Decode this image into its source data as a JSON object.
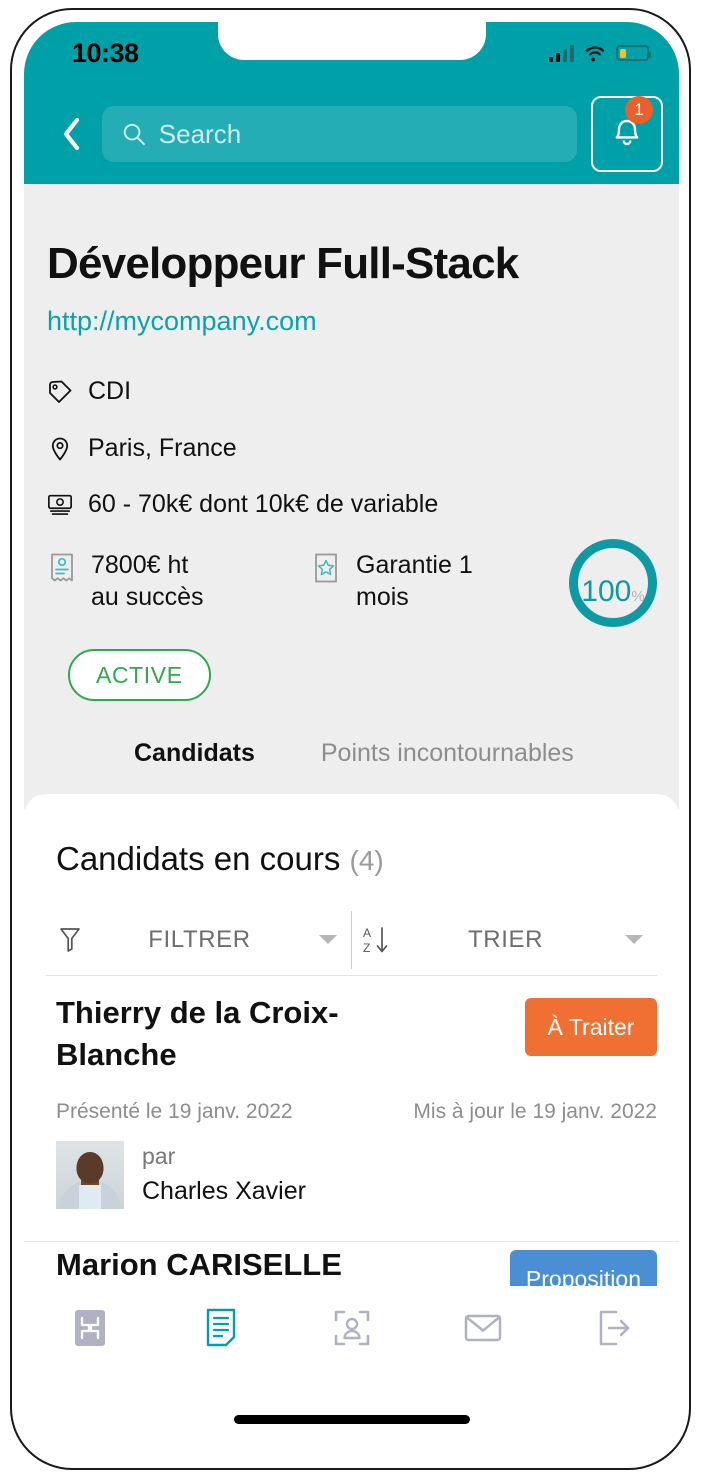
{
  "status_bar": {
    "time": "10:38",
    "signal_icon": "cellular-signal-icon",
    "wifi_icon": "wifi-icon",
    "battery_icon": "battery-low-icon",
    "battery_level_pct": 26
  },
  "header": {
    "back_icon": "chevron-left-icon",
    "search": {
      "icon": "search-icon",
      "placeholder": "Search",
      "value": ""
    },
    "notifications": {
      "icon": "bell-icon",
      "badge_count": "1"
    },
    "background_color": "#00a0a8"
  },
  "job": {
    "title": "Développeur Full-Stack",
    "url": "http://mycompany.com",
    "contract": {
      "icon": "tag-icon",
      "label": "CDI"
    },
    "location": {
      "icon": "map-pin-icon",
      "label": "Paris, France"
    },
    "salary": {
      "icon": "money-icon",
      "label": "60 - 70k€ dont 10k€ de variable"
    },
    "fee": {
      "icon": "receipt-icon",
      "line1": "7800€ ht",
      "line2": "au succès"
    },
    "guarantee": {
      "icon": "certificate-star-icon",
      "line1": "Garantie 1",
      "line2": "mois"
    },
    "score": {
      "value": "100",
      "unit": "%",
      "color": "#0d9aa3"
    },
    "status_badge": {
      "label": "ACTIVE",
      "color": "#2fa84f"
    }
  },
  "tabs": [
    {
      "label": "Candidats",
      "active": true
    },
    {
      "label": "Points incontournables",
      "active": false
    }
  ],
  "candidates_section": {
    "heading": "Candidats en cours",
    "count": "(4)",
    "filter": {
      "icon": "funnel-icon",
      "label": "FILTRER",
      "caret_icon": "caret-down-icon"
    },
    "sort": {
      "icon": "sort-az-icon",
      "label": "TRIER",
      "caret_icon": "caret-down-icon"
    },
    "cards": [
      {
        "name": "Thierry de la Croix-Blanche",
        "status_label": "À Traiter",
        "status_color": "#ef7032",
        "presented": "Présenté le 19 janv. 2022",
        "updated": "Mis à jour le 19 janv. 2022",
        "recruiter_prefix": "par",
        "recruiter_name": "Charles Xavier",
        "avatar_icon": "recruiter-avatar"
      },
      {
        "name": "Marion CARISELLE",
        "status_label": "Proposition",
        "status_color": "#4a8fd4"
      }
    ]
  },
  "bottom_nav": [
    {
      "icon": "dashboard-icon",
      "active": false
    },
    {
      "icon": "document-icon",
      "active": true
    },
    {
      "icon": "candidate-scan-icon",
      "active": false
    },
    {
      "icon": "mail-icon",
      "active": false
    },
    {
      "icon": "logout-icon",
      "active": false
    }
  ],
  "home_indicator": "home-indicator-bar"
}
